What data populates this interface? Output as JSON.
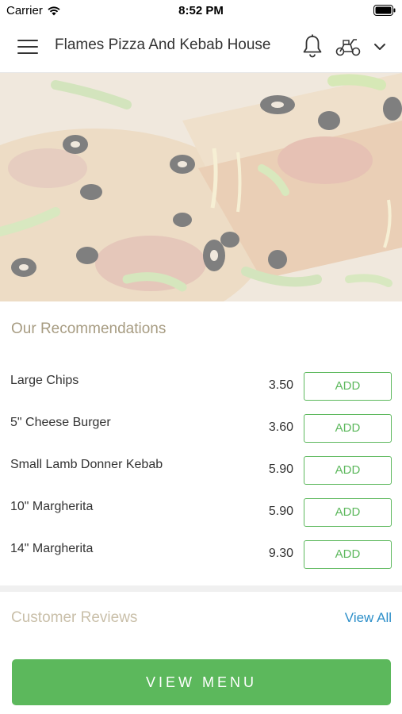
{
  "status_bar": {
    "carrier": "Carrier",
    "time": "8:52 PM",
    "wifi_icon": "wifi-icon",
    "battery_icon": "battery-icon"
  },
  "header": {
    "title": "Flames Pizza And Kebab House",
    "menu_icon": "hamburger-icon",
    "bell_icon": "bell-icon",
    "delivery_icon": "scooter-icon",
    "chevron_icon": "chevron-down-icon"
  },
  "hero": {
    "image": "pizza-photo"
  },
  "recommendations": {
    "title": "Our Recommendations",
    "items": [
      {
        "name": "Large Chips",
        "price": "3.50",
        "button": "ADD"
      },
      {
        "name": "5\" Cheese Burger",
        "price": "3.60",
        "button": "ADD"
      },
      {
        "name": "Small Lamb Donner Kebab",
        "price": "5.90",
        "button": "ADD"
      },
      {
        "name": "10\" Margherita",
        "price": "5.90",
        "button": "ADD"
      },
      {
        "name": "14\" Margherita",
        "price": "9.30",
        "button": "ADD"
      }
    ]
  },
  "reviews": {
    "title": "Customer Reviews",
    "view_all": "View All"
  },
  "footer": {
    "view_menu": "VIEW MENU"
  },
  "colors": {
    "accent_green": "#5cb85c",
    "section_title": "#a79c82",
    "link_blue": "#2d8fc9"
  }
}
